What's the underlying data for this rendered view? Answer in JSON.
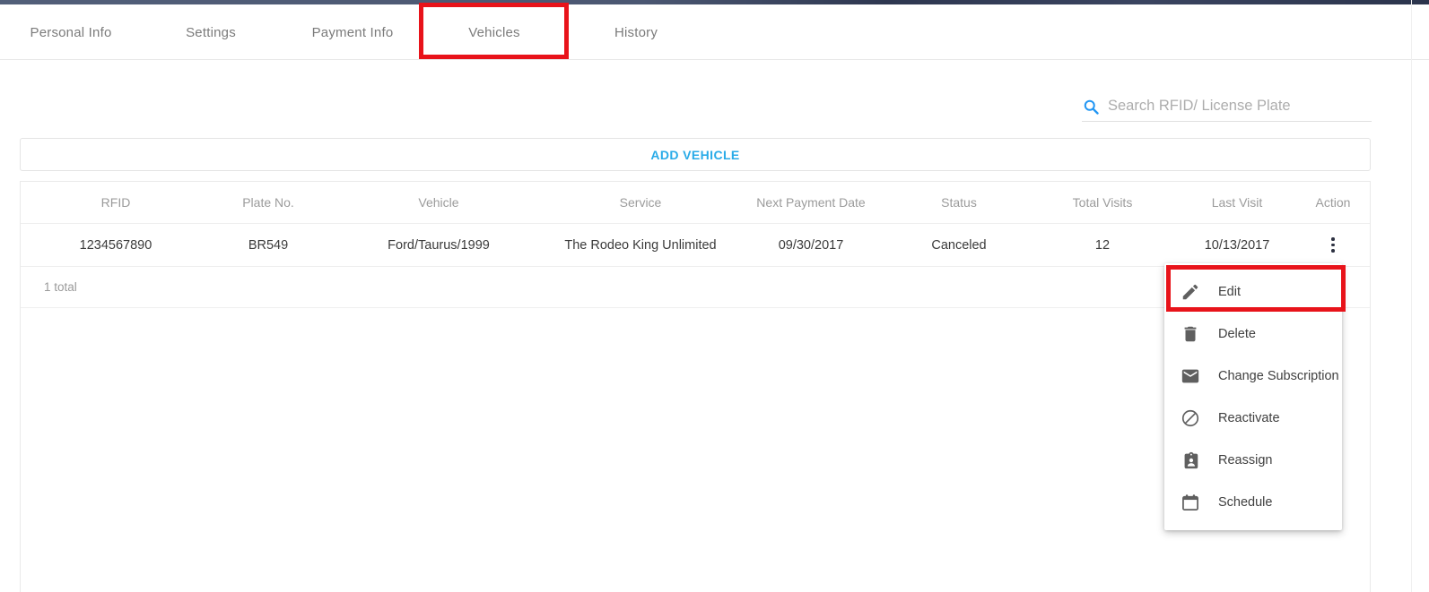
{
  "tabs": [
    {
      "label": "Personal Info",
      "active": false
    },
    {
      "label": "Settings",
      "active": false
    },
    {
      "label": "Payment Info",
      "active": false
    },
    {
      "label": "Vehicles",
      "active": true
    },
    {
      "label": "History",
      "active": false
    }
  ],
  "search": {
    "placeholder": "Search RFID/ License Plate",
    "value": "",
    "icon": "search-icon",
    "icon_color": "#2196f3"
  },
  "toolbar": {
    "add_vehicle_label": "ADD VEHICLE",
    "add_vehicle_color": "#29abe8"
  },
  "table": {
    "columns": [
      "RFID",
      "Plate No.",
      "Vehicle",
      "Service",
      "Next Payment Date",
      "Status",
      "Total Visits",
      "Last Visit",
      "Action"
    ],
    "rows": [
      {
        "rfid": "1234567890",
        "plate_no": "BR549",
        "vehicle": "Ford/Taurus/1999",
        "service": "The Rodeo King Unlimited",
        "next_payment_date": "09/30/2017",
        "status": "Canceled",
        "total_visits": "12",
        "last_visit": "10/13/2017",
        "action_icon": "kebab-menu-icon"
      }
    ],
    "footer_total": "1 total"
  },
  "context_menu": {
    "items": [
      {
        "label": "Edit",
        "icon": "pencil-icon",
        "highlighted": true
      },
      {
        "label": "Delete",
        "icon": "trash-icon",
        "highlighted": false
      },
      {
        "label": "Change Subscription",
        "icon": "envelope-icon",
        "highlighted": false
      },
      {
        "label": "Reactivate",
        "icon": "block-icon",
        "highlighted": false
      },
      {
        "label": "Reassign",
        "icon": "badge-icon",
        "highlighted": false
      },
      {
        "label": "Schedule",
        "icon": "calendar-icon",
        "highlighted": false
      }
    ]
  },
  "annotations": {
    "color": "#e8131a",
    "targets": [
      "Vehicles",
      "Edit"
    ]
  }
}
